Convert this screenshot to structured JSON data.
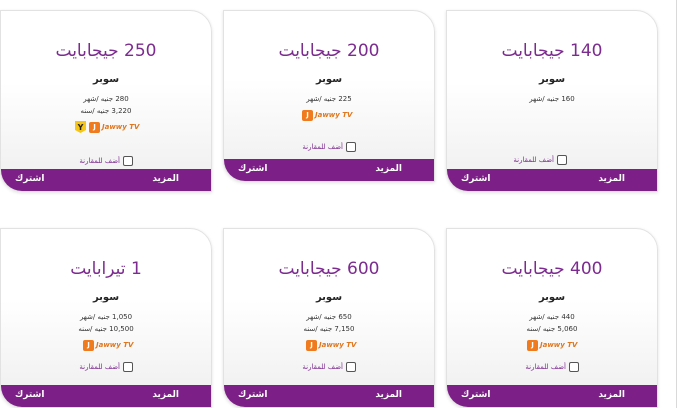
{
  "cards": [
    {
      "title": "250 جيجابايت",
      "plan": "سوبر",
      "price_month": "280 جنيه /شهر",
      "price_year": "3,220 جنيه /سنه",
      "has_jawwy": true,
      "has_shahid": true,
      "jawwy_label": "Jawwy TV",
      "shahid_label": "Y",
      "compare_label": "أضف للمقارنة",
      "subscribe_label": "اشترك",
      "more_label": "المزيد"
    },
    {
      "title": "200 جيجابايت",
      "plan": "سوبر",
      "price_month": "225 جنيه /شهر",
      "price_year": "",
      "has_jawwy": true,
      "has_shahid": false,
      "jawwy_label": "Jawwy TV",
      "shahid_label": "",
      "compare_label": "أضف للمقارنة",
      "subscribe_label": "اشترك",
      "more_label": "المزيد"
    },
    {
      "title": "140 جيجابايت",
      "plan": "سوبر",
      "price_month": "160 جنيه /شهر",
      "price_year": "",
      "has_jawwy": false,
      "has_shahid": false,
      "jawwy_label": "",
      "shahid_label": "",
      "compare_label": "أضف للمقارنة",
      "subscribe_label": "اشترك",
      "more_label": "المزيد"
    },
    {
      "title": "1 تيرابايت",
      "plan": "سوبر",
      "price_month": "1,050 جنيه /شهر",
      "price_year": "10,500 جنيه /سنه",
      "has_jawwy": true,
      "has_shahid": false,
      "jawwy_label": "Jawwy TV",
      "shahid_label": "",
      "compare_label": "أضف للمقارنة",
      "subscribe_label": "اشترك",
      "more_label": "المزيد"
    },
    {
      "title": "600 جيجابايت",
      "plan": "سوبر",
      "price_month": "650 جنيه /شهر",
      "price_year": "7,150 جنيه /سنه",
      "has_jawwy": true,
      "has_shahid": false,
      "jawwy_label": "Jawwy TV",
      "shahid_label": "",
      "compare_label": "أضف للمقارنة",
      "subscribe_label": "اشترك",
      "more_label": "المزيد"
    },
    {
      "title": "400 جيجابايت",
      "plan": "سوبر",
      "price_month": "440 جنيه /شهر",
      "price_year": "5,060 جنيه /سنه",
      "has_jawwy": true,
      "has_shahid": false,
      "jawwy_label": "Jawwy TV",
      "shahid_label": "",
      "compare_label": "أضف للمقارنة",
      "subscribe_label": "اشترك",
      "more_label": "المزيد"
    }
  ],
  "colors": {
    "accent": "#7c1f86",
    "title": "#7c2b8f",
    "jawwy": "#f07b1e",
    "shahid": "#f5c518"
  },
  "icons": {
    "jawwy": "jawwy-tv-logo-icon",
    "shahid": "shahid-logo-icon",
    "checkbox": "checkbox-icon"
  }
}
